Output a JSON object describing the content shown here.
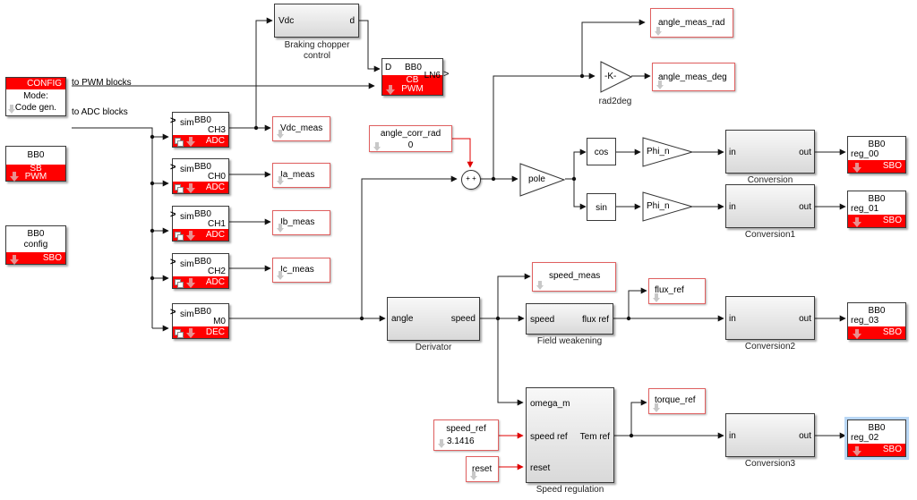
{
  "config_block": {
    "header": "CONFIG",
    "line1": "Mode:",
    "line2": "Code gen.",
    "out1": "to PWM blocks",
    "out2": "to ADC blocks"
  },
  "sb_pwm_block": {
    "title": "BB0",
    "band1": "SB",
    "band2": "PWM"
  },
  "config_sbo_block": {
    "title": "BB0",
    "line2": "config",
    "band": "SBO"
  },
  "adc_blocks": [
    {
      "sim": "sim",
      "title": "BB0",
      "channel": "CH3",
      "band": "ADC",
      "target": "Vdc_meas"
    },
    {
      "sim": "sim",
      "title": "BB0",
      "channel": "CH0",
      "band": "ADC",
      "target": "Ia_meas"
    },
    {
      "sim": "sim",
      "title": "BB0",
      "channel": "CH1",
      "band": "ADC",
      "target": "Ib_meas"
    },
    {
      "sim": "sim",
      "title": "BB0",
      "channel": "CH2",
      "band": "ADC",
      "target": "Ic_meas"
    }
  ],
  "dec_block": {
    "sim": "sim",
    "title": "BB0",
    "channel": "M0",
    "band": "DEC"
  },
  "braking_chopper": {
    "in": "Vdc",
    "out": "d",
    "label_line1": "Braking chopper",
    "label_line2": "control"
  },
  "cb_pwm_block": {
    "in": "D",
    "title": "BB0",
    "out": "LN6",
    "band1": "CB",
    "band2": "PWM"
  },
  "angle_corr": {
    "name": "angle_corr_rad",
    "value": "0"
  },
  "sum_block": {
    "signs": "+ +"
  },
  "pole_gain": {
    "label": "pole"
  },
  "rad2deg_gain": {
    "label": "-K-",
    "caption": "rad2deg"
  },
  "goto_tags": {
    "angle_meas_rad": "angle_meas_rad",
    "angle_meas_deg": "angle_meas_deg",
    "speed_meas": "speed_meas",
    "flux_ref": "flux_ref",
    "torque_ref": "torque_ref"
  },
  "trig": {
    "cos": "cos",
    "sin": "sin"
  },
  "phi_gains": [
    "Phi_n",
    "Phi_n"
  ],
  "conversions": [
    {
      "in": "in",
      "out": "out",
      "caption": "Conversion"
    },
    {
      "in": "in",
      "out": "out",
      "caption": "Conversion1"
    },
    {
      "in": "in",
      "out": "out",
      "caption": "Conversion2"
    },
    {
      "in": "in",
      "out": "out",
      "caption": "Conversion3"
    }
  ],
  "sbo_regs": [
    {
      "title": "BB0",
      "reg": "reg_00",
      "band": "SBO"
    },
    {
      "title": "BB0",
      "reg": "reg_01",
      "band": "SBO"
    },
    {
      "title": "BB0",
      "reg": "reg_03",
      "band": "SBO"
    },
    {
      "title": "BB0",
      "reg": "reg_02",
      "band": "SBO",
      "selected": true
    }
  ],
  "derivator": {
    "in": "angle",
    "out": "speed",
    "caption": "Derivator"
  },
  "field_weakening": {
    "in": "speed",
    "out": "flux ref",
    "caption": "Field weakening"
  },
  "speed_regulation": {
    "in1": "omega_m",
    "in2": "speed ref",
    "in3": "reset",
    "out": "Tem ref",
    "caption": "Speed regulation"
  },
  "speed_ref_const": {
    "name": "speed_ref",
    "value": "3.1416"
  },
  "reset_const": {
    "name": "reset"
  },
  "colors": {
    "accent_red": "#ff0000",
    "tag_border": "#e06060",
    "wire": "#222222",
    "selection": "#b9d7f5"
  }
}
